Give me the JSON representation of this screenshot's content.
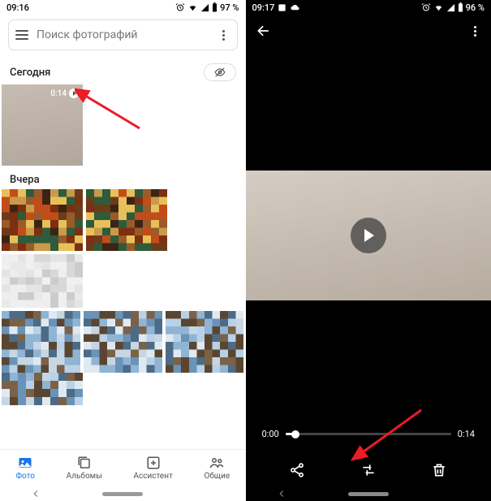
{
  "left": {
    "status": {
      "time": "09:16",
      "battery": "97 %"
    },
    "search": {
      "placeholder": "Поиск фотографий"
    },
    "sections": {
      "today": "Сегодня",
      "yesterday": "Вчера"
    },
    "video_thumb": {
      "duration": "0:14"
    },
    "nav": {
      "photos": "Фото",
      "albums": "Альбомы",
      "assistant": "Ассистент",
      "sharing": "Общие"
    }
  },
  "right": {
    "status": {
      "time": "09:17",
      "battery": "96 %"
    },
    "scrubber": {
      "start": "0:00",
      "end": "0:14"
    }
  },
  "colors": {
    "accent": "#1a73e8",
    "arrow": "#ed1c24"
  }
}
